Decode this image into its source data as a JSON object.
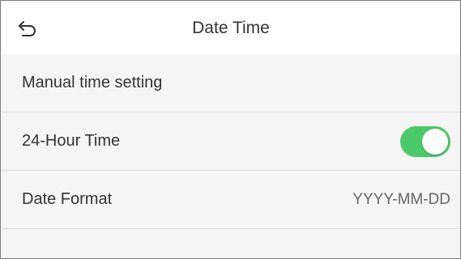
{
  "header": {
    "title": "Date Time",
    "back_icon": "back-arrow-icon"
  },
  "rows": [
    {
      "label": "Manual time setting"
    },
    {
      "label": "24-Hour Time",
      "toggle_on": true
    },
    {
      "label": "Date Format",
      "value": "YYYY-MM-DD"
    }
  ],
  "colors": {
    "toggle_on": "#4cc96a",
    "list_background": "#f5f5f5",
    "header_background": "#ffffff",
    "text": "#333333"
  }
}
